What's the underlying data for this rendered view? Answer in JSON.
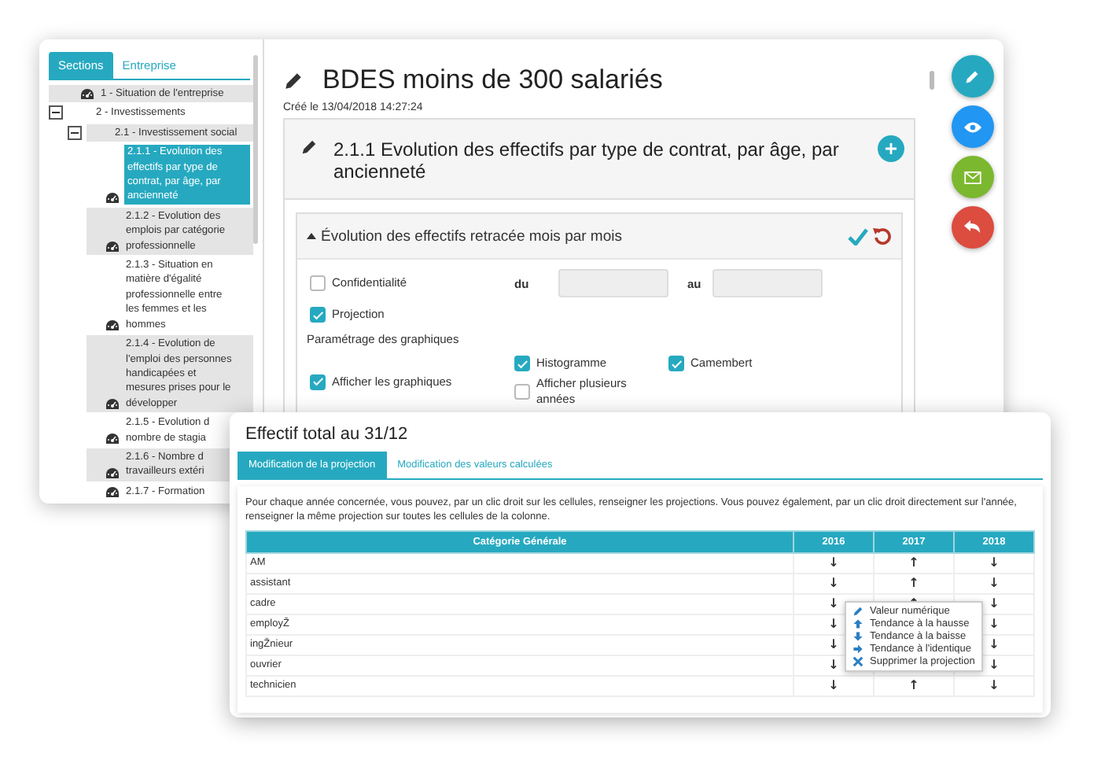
{
  "sidebar": {
    "tabs": [
      {
        "label": "Sections",
        "selected": true
      },
      {
        "label": "Entreprise",
        "selected": false
      }
    ],
    "tree": [
      {
        "label": "1 - Situation de l'entreprise",
        "selected": false
      },
      {
        "label": "2 - Investissements",
        "selected": false,
        "expanded": true,
        "children": [
          {
            "label": "2.1 - Investissement social",
            "selected": false,
            "expanded": true,
            "children": [
              {
                "label": "2.1.1 - Evolution des effectifs par type de contrat, par âge, par ancienneté",
                "selected": true
              },
              {
                "label": "2.1.2 - Evolution des emplois par catégorie professionnelle",
                "selected": false
              },
              {
                "label": "2.1.3 - Situation en matière d'égalité professionnelle entre les femmes et les hommes",
                "selected": false
              },
              {
                "label": "2.1.4 - Evolution de l'emploi des personnes handicapées et mesures prises pour le développer",
                "selected": false
              },
              {
                "label": "2.1.5 - Evolution d nombre de stagia",
                "selected": false
              },
              {
                "label": "2.1.6 - Nombre d travailleurs extéri",
                "selected": false
              },
              {
                "label": "2.1.7 - Formation",
                "selected": false
              }
            ]
          }
        ]
      }
    ]
  },
  "document": {
    "title": "BDES moins de 300 salariés",
    "created": "Créé le 13/04/2018 14:27:24",
    "section_title": "2.1.1 Evolution des effectifs par type de contrat, par âge, par ancienneté",
    "panel_title": "Évolution des effectifs retracée mois par mois",
    "confidentiality": {
      "label": "Confidentialité",
      "checked": false
    },
    "from_label": "du",
    "to_label": "au",
    "projection": {
      "label": "Projection",
      "checked": true
    },
    "charts_heading": "Paramétrage des graphiques",
    "chart_options": [
      {
        "label": "Afficher les graphiques",
        "checked": true
      },
      {
        "label": "Histogramme",
        "checked": true
      },
      {
        "label": "Afficher plusieurs années",
        "checked": false
      },
      {
        "label": "Camembert",
        "checked": true
      }
    ]
  },
  "action_buttons": [
    {
      "kind": "edit",
      "color": "#26a9c0"
    },
    {
      "kind": "view",
      "color": "#2196f3"
    },
    {
      "kind": "mail",
      "color": "#7cb82f"
    },
    {
      "kind": "undo",
      "color": "#dc4c3f"
    }
  ],
  "dialog": {
    "title": "Effectif total au 31/12",
    "tabs": [
      {
        "label": "Modification de la projection",
        "selected": true
      },
      {
        "label": "Modification des valeurs calculées",
        "selected": false
      }
    ],
    "instructions": "Pour chaque année concernée, vous pouvez, par un clic droit sur les cellules, renseigner les projections. Vous pouvez également, par un clic droit directement sur l'année, renseigner la même projection sur toutes les cellules de la colonne.",
    "table": {
      "columns": [
        "Catégorie Générale",
        "2016",
        "2017",
        "2018"
      ],
      "rows": [
        {
          "label": "AM",
          "col_2016": "↓",
          "col_2017": "↑",
          "col_2018": "↓"
        },
        {
          "label": "assistant",
          "col_2016": "↓",
          "col_2017": "↑",
          "col_2018": "↓"
        },
        {
          "label": "cadre",
          "col_2016": "↓",
          "col_2017": "↑",
          "col_2018": "↓"
        },
        {
          "label": "employŽ",
          "col_2016": "↓",
          "col_2018": "↓"
        },
        {
          "label": "ingŽnieur",
          "col_2016": "↓",
          "col_2018": "↓"
        },
        {
          "label": "ouvrier",
          "col_2016": "↓",
          "col_2018": "↓"
        },
        {
          "label": "technicien",
          "col_2016": "↓",
          "col_2017": "↑",
          "col_2018": "↓"
        }
      ]
    },
    "context_menu": [
      {
        "kind": "edit",
        "label": "Valeur numérique"
      },
      {
        "kind": "up",
        "label": "Tendance à la hausse"
      },
      {
        "kind": "down",
        "label": "Tendance à la baisse"
      },
      {
        "kind": "same",
        "label": "Tendance à l'identique"
      },
      {
        "kind": "delete",
        "label": "Supprimer la projection"
      }
    ]
  }
}
